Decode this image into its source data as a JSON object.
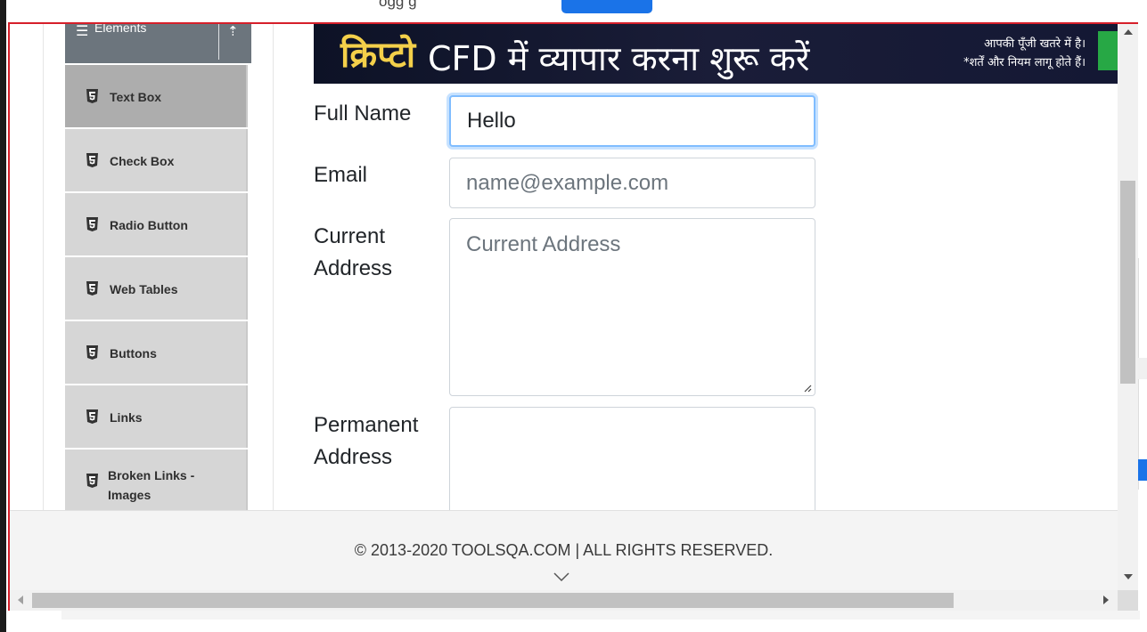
{
  "top_strip": {
    "partial_text": "ogg g"
  },
  "sidebar": {
    "group_label": "Elements",
    "items": [
      {
        "label": "Text Box",
        "active": true
      },
      {
        "label": "Check Box",
        "active": false
      },
      {
        "label": "Radio Button",
        "active": false
      },
      {
        "label": "Web Tables",
        "active": false
      },
      {
        "label": "Buttons",
        "active": false
      },
      {
        "label": "Links",
        "active": false
      },
      {
        "label": "Broken Links - Images",
        "active": false
      }
    ]
  },
  "banner": {
    "hindi_word": "क्रिप्टो",
    "main_text": "CFD में  व्यापार करना शुरू करें",
    "right_line1": "आपकी पूँजी खतरे में है।",
    "right_line2": "*शर्तें और नियम लागू होते हैं।"
  },
  "form": {
    "full_name_label": "Full Name",
    "full_name_value": "Hello",
    "email_label": "Email",
    "email_placeholder": "name@example.com",
    "current_address_label_1": "Current",
    "current_address_label_2": "Address",
    "current_address_placeholder": "Current Address",
    "permanent_address_label_1": "Permanent",
    "permanent_address_label_2": "Address"
  },
  "footer": {
    "copyright": "© 2013-2020 TOOLSQA.COM | ALL RIGHTS RESERVED."
  },
  "colors": {
    "frame_border": "#d61f2a",
    "focus_ring": "#80bdff",
    "menu_active": "#adadad",
    "menu_bg": "#d6d6d6"
  }
}
